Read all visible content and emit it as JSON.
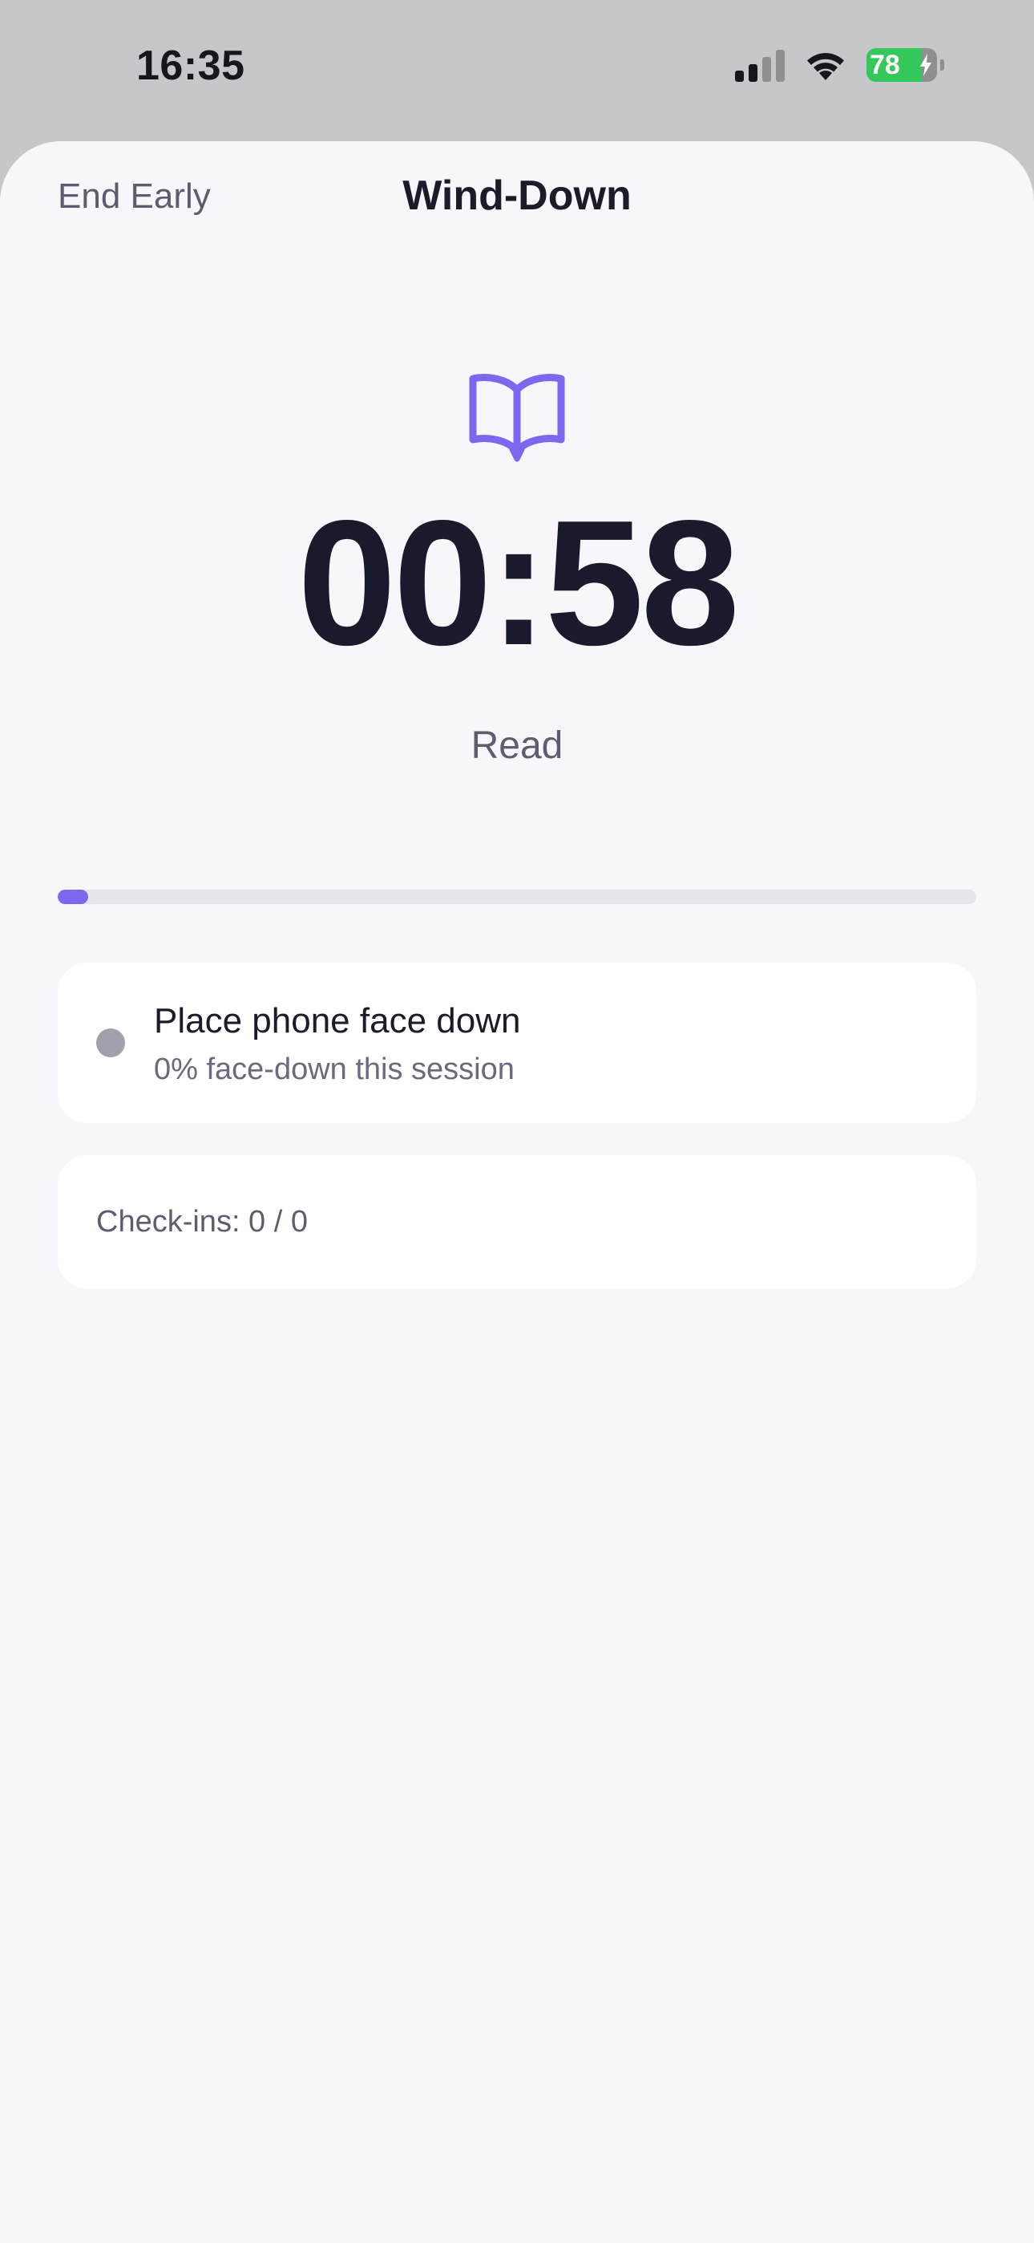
{
  "status_bar": {
    "time": "16:35",
    "battery_percent": "78",
    "battery_level": 0.78,
    "signal_bars_active": 2,
    "signal_bars_total": 4,
    "icons": [
      "signal-icon",
      "wifi-icon",
      "battery-charging-icon"
    ]
  },
  "nav": {
    "end_early_label": "End Early",
    "title": "Wind-Down"
  },
  "session": {
    "activity_icon": "book-open-icon",
    "timer": "00:58",
    "activity_label": "Read",
    "progress": 0.02
  },
  "facedown_card": {
    "title": "Place phone face down",
    "subtitle": "0% face-down this session"
  },
  "checkins_card": {
    "text": "Check-ins: 0 / 0"
  },
  "colors": {
    "accent": "#7b68ee",
    "text_primary": "#1b1b2a",
    "text_secondary": "#5d5d70",
    "background": "#f6f6fb",
    "battery_green": "#34c759",
    "status_dot_inactive": "#a1a1ae"
  }
}
